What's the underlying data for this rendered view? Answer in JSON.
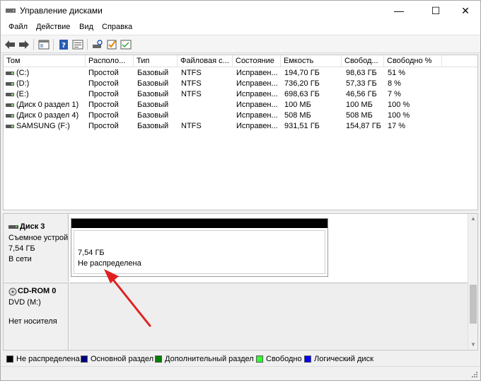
{
  "window": {
    "title": "Управление дисками",
    "controls": {
      "minimize": "—",
      "maximize": "☐",
      "close": "✕"
    }
  },
  "menu": [
    "Файл",
    "Действие",
    "Вид",
    "Справка"
  ],
  "toolbar": [
    "back-arrow-icon",
    "forward-arrow-icon",
    "console-tree-icon",
    "help-icon",
    "properties-icon",
    "rescan-icon",
    "check-icon",
    "settings-icon"
  ],
  "table": {
    "columns": [
      "Том",
      "Располо...",
      "Тип",
      "Файловая с...",
      "Состояние",
      "Емкость",
      "Свобод...",
      "Свободно %"
    ],
    "rows": [
      [
        "(C:)",
        "Простой",
        "Базовый",
        "NTFS",
        "Исправен...",
        "194,70 ГБ",
        "98,63 ГБ",
        "51 %"
      ],
      [
        "(D:)",
        "Простой",
        "Базовый",
        "NTFS",
        "Исправен...",
        "736,20 ГБ",
        "57,33 ГБ",
        "8 %"
      ],
      [
        "(E:)",
        "Простой",
        "Базовый",
        "NTFS",
        "Исправен...",
        "698,63 ГБ",
        "46,56 ГБ",
        "7 %"
      ],
      [
        "(Диск 0 раздел 1)",
        "Простой",
        "Базовый",
        "",
        "Исправен...",
        "100 МБ",
        "100 МБ",
        "100 %"
      ],
      [
        "(Диск 0 раздел 4)",
        "Простой",
        "Базовый",
        "",
        "Исправен...",
        "508 МБ",
        "508 МБ",
        "100 %"
      ],
      [
        "SAMSUNG (F:)",
        "Простой",
        "Базовый",
        "NTFS",
        "Исправен...",
        "931,51 ГБ",
        "154,87 ГБ",
        "17 %"
      ]
    ]
  },
  "disks": {
    "disk3": {
      "name": "Диск 3",
      "type": "Съемное устройство",
      "size": "7,54 ГБ",
      "status": "В сети",
      "partition_size": "7,54 ГБ",
      "partition_status": "Не распределена"
    },
    "cdrom": {
      "name": "CD-ROM 0",
      "drive": "DVD (M:)",
      "media": "Нет носителя"
    }
  },
  "legend": [
    {
      "label": "Не распределена",
      "color": "#000000"
    },
    {
      "label": "Основной раздел",
      "color": "#000080"
    },
    {
      "label": "Дополнительный раздел",
      "color": "#008000"
    },
    {
      "label": "Свободно",
      "color": "#33ff33"
    },
    {
      "label": "Логический диск",
      "color": "#0000ff"
    }
  ],
  "annotation_color": "#e02020"
}
